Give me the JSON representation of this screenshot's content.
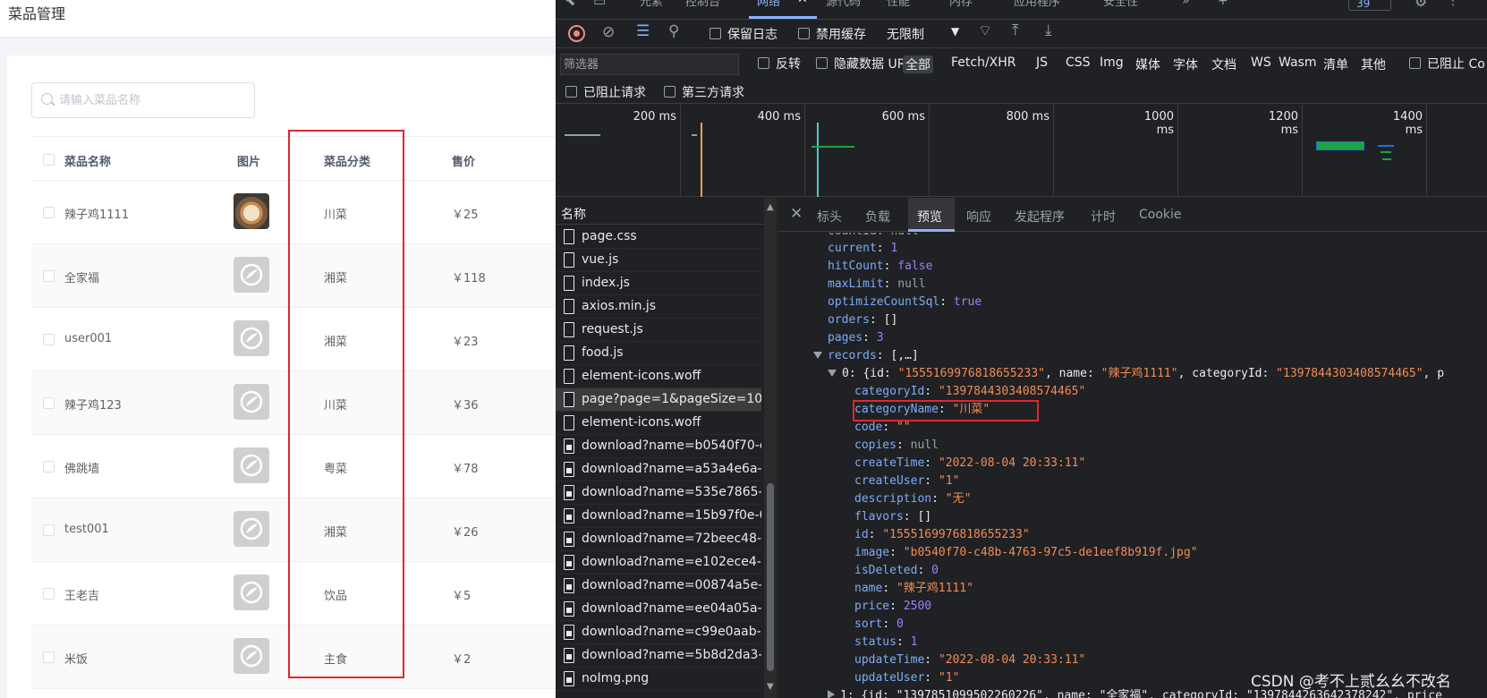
{
  "app": {
    "title": "菜品管理",
    "search": {
      "placeholder": "请输入菜品名称",
      "value": ""
    },
    "table": {
      "headers": [
        "菜品名称",
        "图片",
        "菜品分类",
        "售价"
      ],
      "rows": [
        {
          "name": "辣子鸡1111",
          "image": "photo",
          "category": "川菜",
          "price": "￥25"
        },
        {
          "name": "全家福",
          "image": "placeholder",
          "category": "湘菜",
          "price": "￥118"
        },
        {
          "name": "user001",
          "image": "placeholder",
          "category": "湘菜",
          "price": "￥23"
        },
        {
          "name": "辣子鸡123",
          "image": "placeholder",
          "category": "川菜",
          "price": "￥36"
        },
        {
          "name": "佛跳墙",
          "image": "placeholder",
          "category": "粤菜",
          "price": "￥78"
        },
        {
          "name": "test001",
          "image": "placeholder",
          "category": "湘菜",
          "price": "￥26"
        },
        {
          "name": "王老吉",
          "image": "placeholder",
          "category": "饮品",
          "price": "￥5"
        },
        {
          "name": "米饭",
          "image": "placeholder",
          "category": "主食",
          "price": "￥2"
        }
      ]
    },
    "highlight_color": "#e0272f"
  },
  "devtools": {
    "panel_tabs": [
      "元素",
      "控制台",
      "网络",
      "源代码",
      "性能",
      "内存",
      "应用程序",
      "安全性"
    ],
    "active_panel": "网络",
    "issues_count": "39",
    "toolbar": {
      "preserve_log": "保留日志",
      "disable_cache": "禁用缓存",
      "throttling": "无限制"
    },
    "filter": {
      "placeholder": "筛选器",
      "invert": "反转",
      "hide_data_urls": "隐藏数据 URL",
      "types": [
        "全部",
        "Fetch/XHR",
        "JS",
        "CSS",
        "Img",
        "媒体",
        "字体",
        "文档",
        "WS",
        "Wasm",
        "清单",
        "其他"
      ],
      "blocked_cookies": "已阻止 Co",
      "blocked_requests": "已阻止请求",
      "third_party": "第三方请求"
    },
    "timeline_ticks": [
      "200 ms",
      "400 ms",
      "600 ms",
      "800 ms",
      "1000 ms",
      "1200 ms",
      "1400 ms"
    ],
    "name_header": "名称",
    "requests": [
      {
        "name": "page.css",
        "icon": "file"
      },
      {
        "name": "vue.js",
        "icon": "file"
      },
      {
        "name": "index.js",
        "icon": "file"
      },
      {
        "name": "axios.min.js",
        "icon": "file"
      },
      {
        "name": "request.js",
        "icon": "file"
      },
      {
        "name": "food.js",
        "icon": "file"
      },
      {
        "name": "element-icons.woff",
        "icon": "file"
      },
      {
        "name": "page?page=1&pageSize=10",
        "icon": "file",
        "selected": true
      },
      {
        "name": "element-icons.woff",
        "icon": "file"
      },
      {
        "name": "download?name=b0540f70-c...",
        "icon": "img"
      },
      {
        "name": "download?name=a53a4e6a-3...",
        "icon": "img"
      },
      {
        "name": "download?name=535e7865-9...",
        "icon": "img"
      },
      {
        "name": "download?name=15b97f0e-0...",
        "icon": "img"
      },
      {
        "name": "download?name=72beec48-6...",
        "icon": "img"
      },
      {
        "name": "download?name=e102ece4-c...",
        "icon": "img"
      },
      {
        "name": "download?name=00874a5e-0...",
        "icon": "img"
      },
      {
        "name": "download?name=ee04a05a-1...",
        "icon": "img"
      },
      {
        "name": "download?name=c99e0aab-3...",
        "icon": "img"
      },
      {
        "name": "download?name=5b8d2da3-3...",
        "icon": "img"
      },
      {
        "name": "noImg.png",
        "icon": "img"
      }
    ],
    "detail_tabs": [
      "标头",
      "负载",
      "预览",
      "响应",
      "发起程序",
      "计时",
      "Cookie"
    ],
    "active_detail_tab": "预览",
    "preview": {
      "countId": "countId: null",
      "current": "1",
      "hitCount": "false",
      "maxLimit": "null",
      "optimizeCountSql": "true",
      "orders": "[]",
      "pages": "3",
      "records_summary": "[,…]",
      "rec0_summary_a": "0: {id: ",
      "rec0_id": "\"1555169976818655233\"",
      "rec0_summary_b": ", name: ",
      "rec0_name": "\"辣子鸡1111\"",
      "rec0_summary_c": ", categoryId: ",
      "rec0_cat": "\"1397844303408574465\"",
      "rec0_summary_d": ", p",
      "fields": [
        {
          "k": "categoryId",
          "v": "\"1397844303408574465\"",
          "t": "s"
        },
        {
          "k": "categoryName",
          "v": "\"川菜\"",
          "t": "s"
        },
        {
          "k": "code",
          "v": "\"\"",
          "t": "s"
        },
        {
          "k": "copies",
          "v": "null",
          "t": "nl"
        },
        {
          "k": "createTime",
          "v": "\"2022-08-04 20:33:11\"",
          "t": "s"
        },
        {
          "k": "createUser",
          "v": "\"1\"",
          "t": "s"
        },
        {
          "k": "description",
          "v": "\"无\"",
          "t": "s"
        },
        {
          "k": "flavors",
          "v": "[]",
          "t": "p"
        },
        {
          "k": "id",
          "v": "\"1555169976818655233\"",
          "t": "s"
        },
        {
          "k": "image",
          "v": "\"b0540f70-c48b-4763-97c5-de1eef8b919f.jpg\"",
          "t": "s"
        },
        {
          "k": "isDeleted",
          "v": "0",
          "t": "n"
        },
        {
          "k": "name",
          "v": "\"辣子鸡1111\"",
          "t": "s"
        },
        {
          "k": "price",
          "v": "2500",
          "t": "n"
        },
        {
          "k": "sort",
          "v": "0",
          "t": "n"
        },
        {
          "k": "status",
          "v": "1",
          "t": "n"
        },
        {
          "k": "updateTime",
          "v": "\"2022-08-04 20:33:11\"",
          "t": "s"
        },
        {
          "k": "updateUser",
          "v": "\"1\"",
          "t": "s"
        }
      ],
      "rec1_summary": "1: {id: \"1397851099502260226\", name: \"全家福\", categoryId: \"1397844263642378242\", price"
    }
  },
  "watermark": "CSDN @考不上贰幺幺不改名"
}
